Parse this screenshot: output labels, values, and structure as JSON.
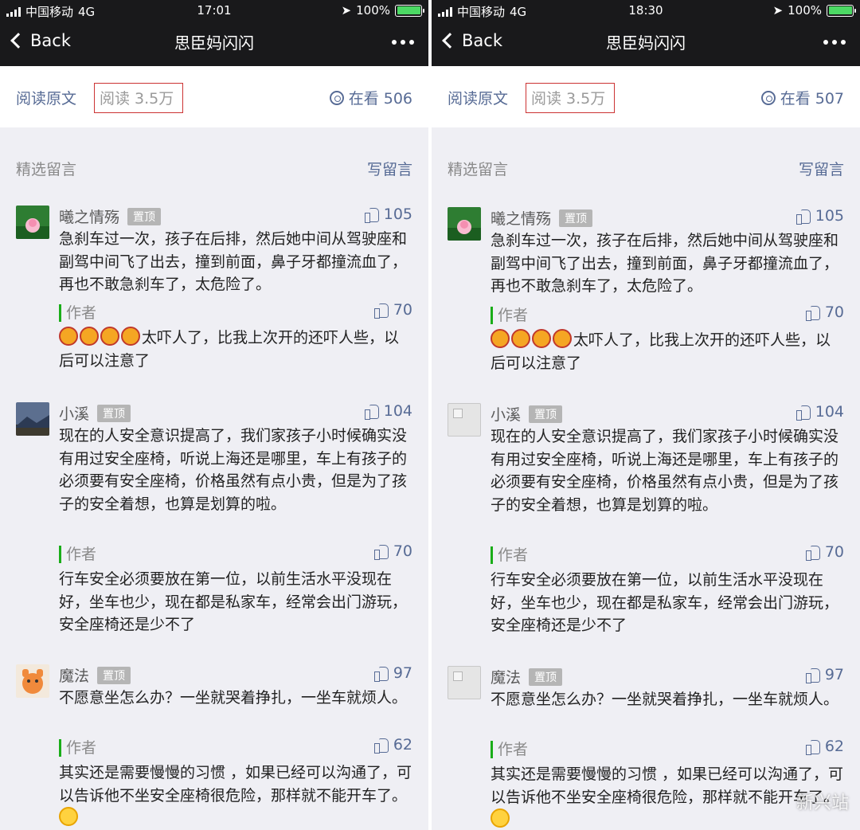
{
  "panels": [
    {
      "status": {
        "carrier": "中国移动",
        "network": "4G",
        "time": "17:01",
        "battery": "100%"
      },
      "nav": {
        "back": "Back",
        "title": "思臣妈闪闪"
      },
      "read_bar": {
        "original": "阅读原文",
        "reads": "阅读  3.5万",
        "looking": "在看 506"
      },
      "section": {
        "label": "精选留言",
        "write": "写留言"
      },
      "comments": [
        {
          "name": "曦之情殇",
          "pin": "置顶",
          "likes": "105",
          "text": "急刹车过一次，孩子在后排，然后她中间从驾驶座和副驾中间飞了出去，撞到前面，鼻子牙都撞流血了，再也不敢急刹车了，太危险了。",
          "reply": {
            "author": "作者",
            "likes": "70",
            "text": "太吓人了，比我上次开的还吓人些，以后可以注意了"
          }
        },
        {
          "name": "小溪",
          "pin": "置顶",
          "likes": "104",
          "text": "现在的人安全意识提高了，我们家孩子小时候确实没有用过安全座椅，听说上海还是哪里，车上有孩子的必须要有安全座椅，价格虽然有点小贵，但是为了孩子的安全着想，也算是划算的啦。",
          "reply": {
            "author": "作者",
            "likes": "70",
            "text": "行车安全必须要放在第一位，以前生活水平没现在好，坐车也少，现在都是私家车，经常会出门游玩，安全座椅还是少不了"
          }
        },
        {
          "name": "魔法",
          "pin": "置顶",
          "likes": "97",
          "text": "不愿意坐怎么办？一坐就哭着挣扎，一坐车就烦人。",
          "reply": {
            "author": "作者",
            "likes": "62",
            "text": "其实还是需要慢慢的习惯 ，如果已经可以沟通了，可以告诉他不坐安全座椅很危险，那样就不能开车了。"
          }
        }
      ]
    },
    {
      "status": {
        "carrier": "中国移动",
        "network": "4G",
        "time": "18:30",
        "battery": "100%"
      },
      "nav": {
        "back": "Back",
        "title": "思臣妈闪闪"
      },
      "read_bar": {
        "original": "阅读原文",
        "reads": "阅读  3.5万",
        "looking": "在看 507"
      },
      "section": {
        "label": "精选留言",
        "write": "写留言"
      },
      "comments": [
        {
          "name": "曦之情殇",
          "pin": "置顶",
          "likes": "105",
          "text": "急刹车过一次，孩子在后排，然后她中间从驾驶座和副驾中间飞了出去，撞到前面，鼻子牙都撞流血了，再也不敢急刹车了，太危险了。",
          "reply": {
            "author": "作者",
            "likes": "70",
            "text": "太吓人了，比我上次开的还吓人些，以后可以注意了"
          }
        },
        {
          "name": "小溪",
          "pin": "置顶",
          "likes": "104",
          "text": "现在的人安全意识提高了，我们家孩子小时候确实没有用过安全座椅，听说上海还是哪里，车上有孩子的必须要有安全座椅，价格虽然有点小贵，但是为了孩子的安全着想，也算是划算的啦。",
          "reply": {
            "author": "作者",
            "likes": "70",
            "text": "行车安全必须要放在第一位，以前生活水平没现在好，坐车也少，现在都是私家车，经常会出门游玩，安全座椅还是少不了"
          }
        },
        {
          "name": "魔法",
          "pin": "置顶",
          "likes": "97",
          "text": "不愿意坐怎么办？一坐就哭着挣扎，一坐车就烦人。",
          "reply": {
            "author": "作者",
            "likes": "62",
            "text": "其实还是需要慢慢的习惯 ，如果已经可以沟通了，可以告诉他不坐安全座椅很危险，那样就不能开车了。"
          }
        }
      ],
      "watermark": "新兴站"
    }
  ]
}
